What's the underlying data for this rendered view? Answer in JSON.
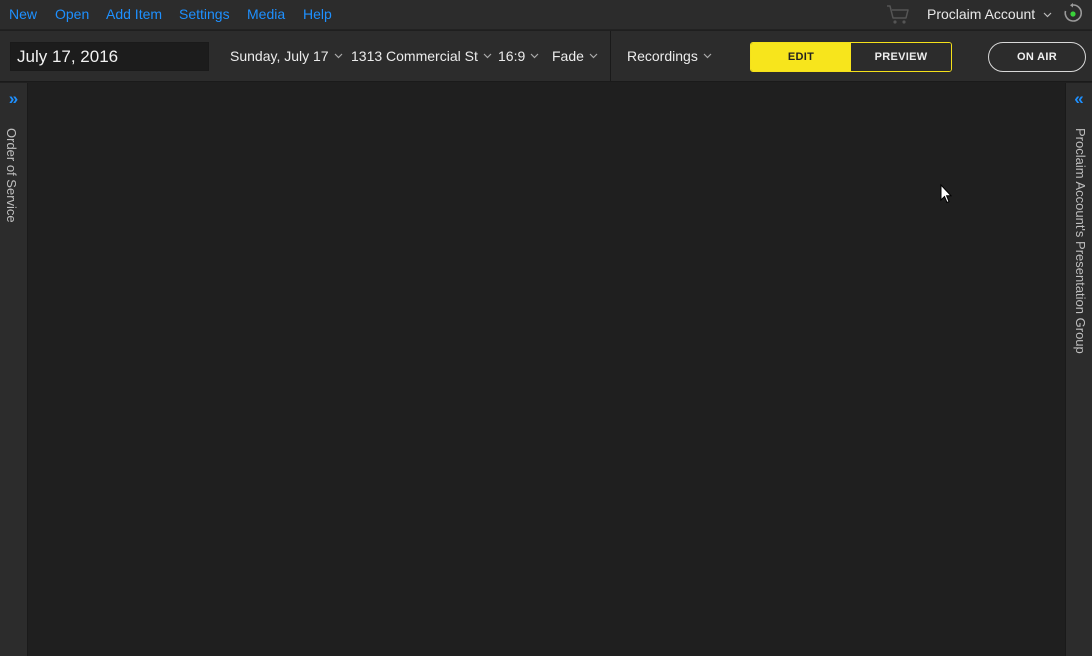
{
  "menu": {
    "new": "New",
    "open": "Open",
    "add_item": "Add Item",
    "settings": "Settings",
    "media": "Media",
    "help": "Help"
  },
  "account": {
    "name": "Proclaim Account"
  },
  "toolbar": {
    "date_value": "July 17, 2016",
    "service_day": "Sunday, July 17",
    "location": "1313 Commercial St",
    "aspect_ratio": "16:9",
    "transition": "Fade",
    "recordings": "Recordings",
    "edit_label": "EDIT",
    "preview_label": "PREVIEW",
    "on_air_label": "ON AIR"
  },
  "left_panel": {
    "label": "Order of Service",
    "toggle_glyph": "»"
  },
  "right_panel": {
    "label": "Proclaim Account's Presentation Group",
    "toggle_glyph": "«"
  },
  "colors": {
    "link_blue": "#1e90ff",
    "accent_yellow": "#f7e51c",
    "bar_bg": "#2c2c2c",
    "canvas_bg": "#1f1f1f",
    "sync_green": "#3ad13a"
  },
  "icons": {
    "cart": "shopping-cart-icon",
    "sync": "sync-icon",
    "chevron": "chevron-down-icon"
  }
}
